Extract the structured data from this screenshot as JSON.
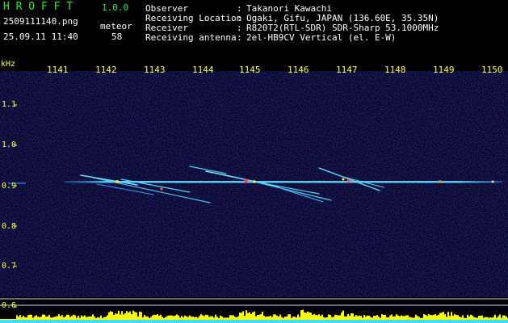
{
  "app": {
    "title": "H R O F F T",
    "version": "1.0.0"
  },
  "file": {
    "name": "2509111140.png",
    "datetime": "25.09.11 11:40"
  },
  "meteor": {
    "label": "meteor",
    "count": "58"
  },
  "info": [
    {
      "key": "Observer",
      "sep": ":",
      "value": "Takanori Kawachi"
    },
    {
      "key": "Receiving Location",
      "sep": ":",
      "value": "Ogaki, Gifu, JAPAN (136.60E, 35.35N)"
    },
    {
      "key": "Receiver",
      "sep": ":",
      "value": "R820T2(RTL-SDR) SDR-Sharp 53.1000MHz"
    },
    {
      "key": "Receiving antenna",
      "sep": ":",
      "value": "2el-HB9CV Vertical (el. E-W)"
    }
  ],
  "axis": {
    "y_unit": "kHz",
    "y_ticks": [
      "1.1",
      "1.0",
      "0.9",
      "0.8",
      "0.7",
      "0.6"
    ],
    "x_ticks": [
      "1141",
      "1142",
      "1143",
      "1144",
      "1145",
      "1146",
      "1147",
      "1148",
      "1149",
      "1150"
    ]
  },
  "colors": {
    "title_green": "#22ee22",
    "tick_yellow": "#ffff44",
    "noise_blue": "#0a0a6a",
    "signal_cyan": "#55ddff",
    "baseline_yellow": "#ffff00",
    "baseline_cyan": "#44ddff"
  }
}
